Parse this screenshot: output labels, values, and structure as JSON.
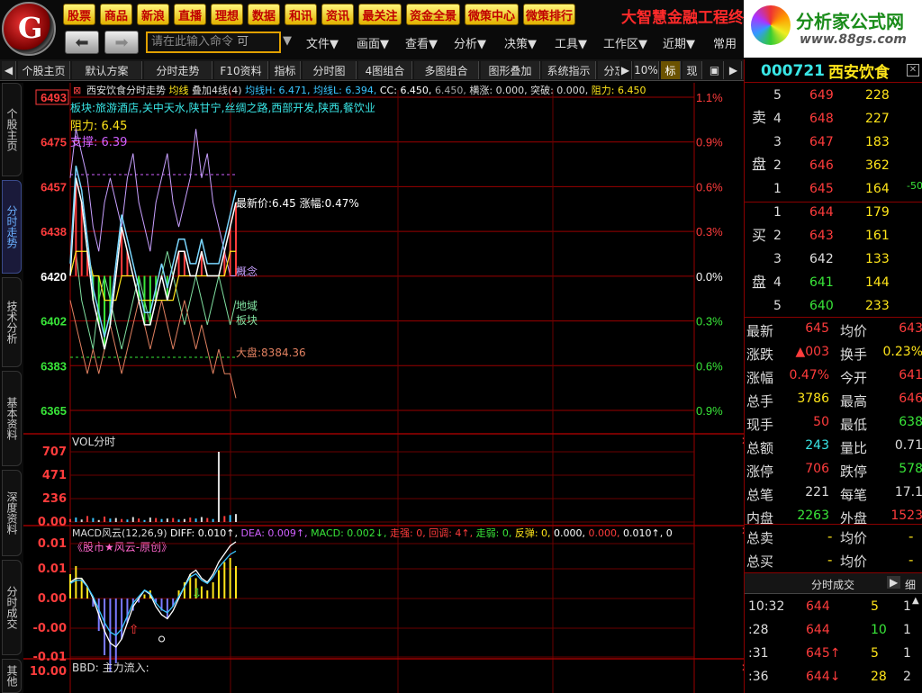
{
  "toolbar": {
    "logo": "G",
    "buttons": [
      "股票",
      "商品",
      "新浪",
      "直播",
      "理想",
      "数据",
      "和讯",
      "资讯",
      "最关注",
      "资金全景",
      "微策中心",
      "微策排行"
    ],
    "brand_text": "大智慧金融工程终",
    "brand_logo_name": "分析家公式网",
    "brand_logo_url": "www.88gs.com",
    "command_placeholder": "请在此输入命令",
    "command_suffix": "可",
    "menus": [
      "文件▼",
      "画面▼",
      "查看▼",
      "分析▼",
      "决策▼",
      "工具▼",
      "工作区▼",
      "近期▼",
      "常用"
    ]
  },
  "tabs": [
    "个股主页",
    "默认方案",
    "分时走势",
    "F10资料",
    "指标",
    "分时图",
    "4图组合",
    "多图组合",
    "图形叠加",
    "系统指示",
    "分忘",
    "10%",
    "标",
    "现"
  ],
  "side_tabs": [
    "个股主页",
    "分时走势",
    "技术分析",
    "基本资料",
    "深度资料",
    "分时成交",
    "其他"
  ],
  "main_chart": {
    "header": "西安饮食分时走势",
    "header_avg": "均线",
    "header_overlay": "叠加4线(4)",
    "header_avgH": "均线H: 6.471",
    "header_avgL": "均线L: 6.394",
    "header_cc": "CC: 6.450",
    "header_cc2": "6.450",
    "header_rest": "横涨: 0.000, 突破: 0.000,",
    "header_resist": "阻力: 6.450",
    "sector_label": "板块:",
    "sector_text": "旅游酒店,关中天水,陕甘宁,丝绸之路,西部开发,陕西,餐饮业",
    "resist_label": "阻力: 6.45",
    "support_label": "支撑: 6.39",
    "price_annot": "最新价:6.45 涨幅:0.47%",
    "legend_concept": "概念",
    "legend_region": "地域",
    "legend_sector": "板块",
    "legend_market": "大盘:8384.36"
  },
  "vol_panel": {
    "title": "VOL分时"
  },
  "macd_panel": {
    "title": "MACD风云(12,26,9)",
    "diff": "DIFF: 0.010↑",
    "dea": "DEA: 0.009↑",
    "macd": "MACD: 0.002↓",
    "strong": "走强: 0",
    "pullback": "回调: 4↑",
    "weak": "走弱: 0",
    "rebound": "反弹: 0",
    "extra1": "0.000",
    "extra2": "0.000",
    "extra3": "0.010↑",
    "extra4": "0",
    "subtitle": "《股市★风云-原创》"
  },
  "bbd_panel": {
    "title": "BBD",
    "label": "BBD: 主力流入:"
  },
  "chart_data": {
    "type": "line",
    "title": "西安饮食分时走势",
    "price_axis": [
      "6493",
      "6475",
      "6457",
      "6438",
      "6420",
      "6402",
      "6383",
      "6365"
    ],
    "pct_axis": [
      "1.1%",
      "0.9%",
      "0.6%",
      "0.3%",
      "0.0%",
      "0.3%",
      "0.6%",
      "0.9%"
    ],
    "ylim": [
      6.36,
      6.495
    ],
    "base_price": 6.42,
    "price_series": [
      6.42,
      6.46,
      6.45,
      6.43,
      6.41,
      6.4,
      6.39,
      6.4,
      6.42,
      6.44,
      6.43,
      6.42,
      6.41,
      6.4,
      6.4,
      6.41,
      6.42,
      6.41,
      6.42,
      6.43,
      6.43,
      6.42,
      6.42,
      6.43,
      6.42,
      6.42,
      6.42,
      6.43,
      6.44,
      6.45
    ],
    "vol_axis": [
      "707",
      "471",
      "236",
      "0.00"
    ],
    "vol_series": [
      30,
      45,
      25,
      60,
      40,
      20,
      55,
      35,
      40,
      30,
      25,
      50,
      35,
      20,
      45,
      40,
      30,
      35,
      40,
      25,
      30,
      45,
      35,
      50,
      40,
      30,
      707,
      60,
      70,
      80
    ],
    "macd_axis": [
      "0.01",
      "0.01",
      "0.00",
      "-0.00",
      "-0.01"
    ],
    "bbd_axis": [
      "10.00"
    ]
  },
  "quote": {
    "code": "000721",
    "name": "西安饮食",
    "sell_label": [
      "卖",
      "盘"
    ],
    "buy_label": [
      "买",
      "盘"
    ],
    "asks": [
      [
        "5",
        "649",
        "228"
      ],
      [
        "4",
        "648",
        "227"
      ],
      [
        "3",
        "647",
        "183"
      ],
      [
        "2",
        "646",
        "362"
      ],
      [
        "1",
        "645",
        "164"
      ]
    ],
    "ask_extra": "-50",
    "bids": [
      [
        "1",
        "644",
        "179"
      ],
      [
        "2",
        "643",
        "161"
      ],
      [
        "3",
        "642",
        "133"
      ],
      [
        "4",
        "641",
        "144"
      ],
      [
        "5",
        "640",
        "233"
      ]
    ],
    "stats": [
      [
        "最新",
        "645",
        "均价",
        "643"
      ],
      [
        "涨跌",
        "▲003",
        "换手",
        "0.23%"
      ],
      [
        "涨幅",
        "0.47%",
        "今开",
        "641"
      ],
      [
        "总手",
        "3786",
        "最高",
        "646"
      ],
      [
        "现手",
        "50",
        "最低",
        "638"
      ],
      [
        "总额",
        "243",
        "量比",
        "0.71"
      ],
      [
        "涨停",
        "706",
        "跌停",
        "578"
      ],
      [
        "总笔",
        "221",
        "每笔",
        "17.1"
      ],
      [
        "内盘",
        "2263",
        "外盘",
        "1523"
      ]
    ],
    "total_sell": [
      "总卖",
      "-",
      "均价",
      "-"
    ],
    "total_buy": [
      "总买",
      "-",
      "均价",
      "-"
    ],
    "trades_title": "分时成交",
    "trades_btn": "细",
    "trades": [
      [
        "10:32",
        "644",
        "5",
        "1"
      ],
      [
        ":28",
        "644",
        "10",
        "1"
      ],
      [
        ":31",
        "645↑",
        "5",
        "1"
      ],
      [
        ":36",
        "644↓",
        "28",
        "2"
      ]
    ]
  }
}
